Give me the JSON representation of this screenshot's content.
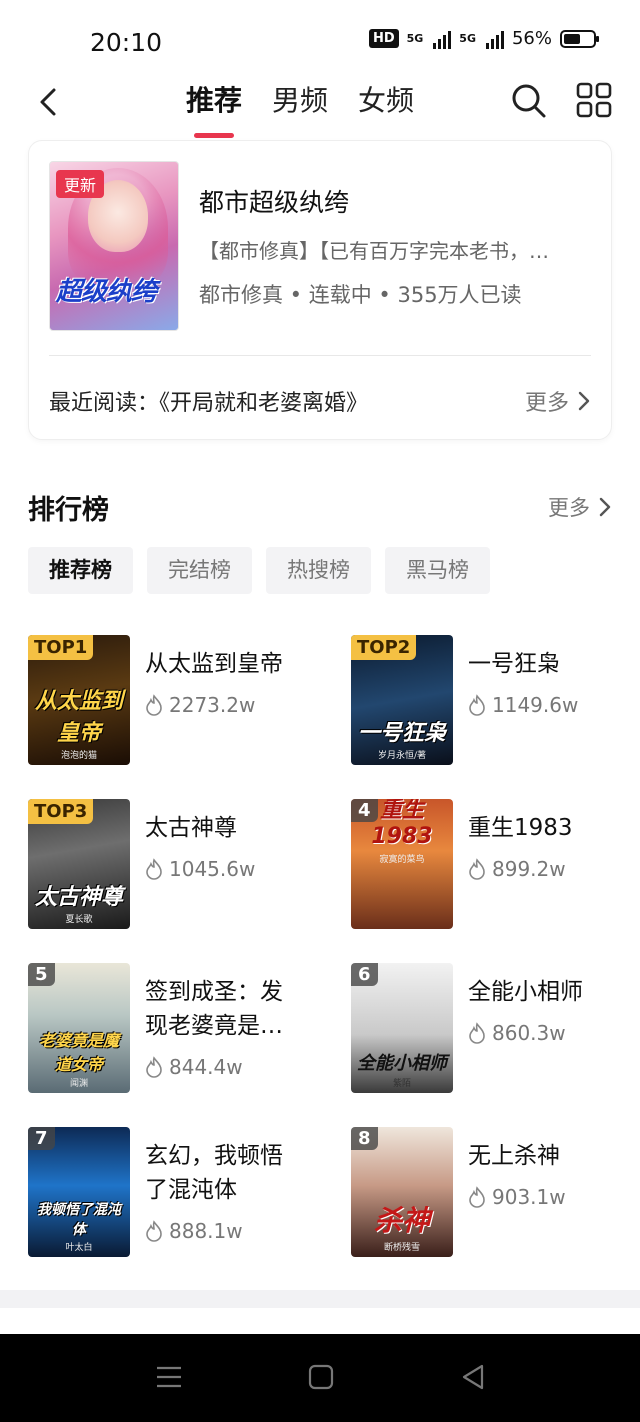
{
  "status": {
    "time": "20:10",
    "hd": "HD",
    "net1": "5G",
    "net2": "5G",
    "battery": "56%",
    "battery_level": 0.56
  },
  "nav": {
    "tabs": [
      {
        "label": "推荐",
        "active": true
      },
      {
        "label": "男频",
        "active": false
      },
      {
        "label": "女频",
        "active": false
      }
    ],
    "accent": "#e8364e"
  },
  "featured": {
    "badge": "更新",
    "cover_art_title": "超级纨绔",
    "title": "都市超级纨绔",
    "description": "【都市修真】【已有百万字完本老书，…",
    "meta": "都市修真 • 连载中 • 355万人已读",
    "recent_label": "最近阅读：《开局就和老婆离婚》",
    "more": "更多"
  },
  "ranking": {
    "title": "排行榜",
    "more": "更多",
    "chips": [
      {
        "label": "推荐榜",
        "active": true
      },
      {
        "label": "完结榜",
        "active": false
      },
      {
        "label": "热搜榜",
        "active": false
      },
      {
        "label": "黑马榜",
        "active": false
      }
    ],
    "items": [
      {
        "rank": "TOP1",
        "name": "从太监到皇帝",
        "heat": "2273.2w",
        "art": "从太监到皇帝",
        "art_sub": "泡泡的猫"
      },
      {
        "rank": "TOP2",
        "name": "一号狂枭",
        "heat": "1149.6w",
        "art": "一号狂枭",
        "art_sub": "岁月永恒/著"
      },
      {
        "rank": "TOP3",
        "name": "太古神尊",
        "heat": "1045.6w",
        "art": "太古神尊",
        "art_sub": "夏长歌"
      },
      {
        "rank": "4",
        "name": "重生1983",
        "heat": "899.2w",
        "art": "重生1983",
        "art_sub": "寂寞的菜鸟"
      },
      {
        "rank": "5",
        "name": "签到成圣：发现老婆竟是…",
        "heat": "844.4w",
        "art": "老婆竟是魔道女帝",
        "art_sub": "闻渊"
      },
      {
        "rank": "6",
        "name": "全能小相师",
        "heat": "860.3w",
        "art": "全能小相师",
        "art_sub": "紫陌"
      },
      {
        "rank": "7",
        "name": "玄幻，我顿悟了混沌体",
        "heat": "888.1w",
        "art": "我顿悟了混沌体",
        "art_sub": "叶太白"
      },
      {
        "rank": "8",
        "name": "无上杀神",
        "heat": "903.1w",
        "art": "杀神",
        "art_sub": "断桥残雪"
      }
    ]
  }
}
